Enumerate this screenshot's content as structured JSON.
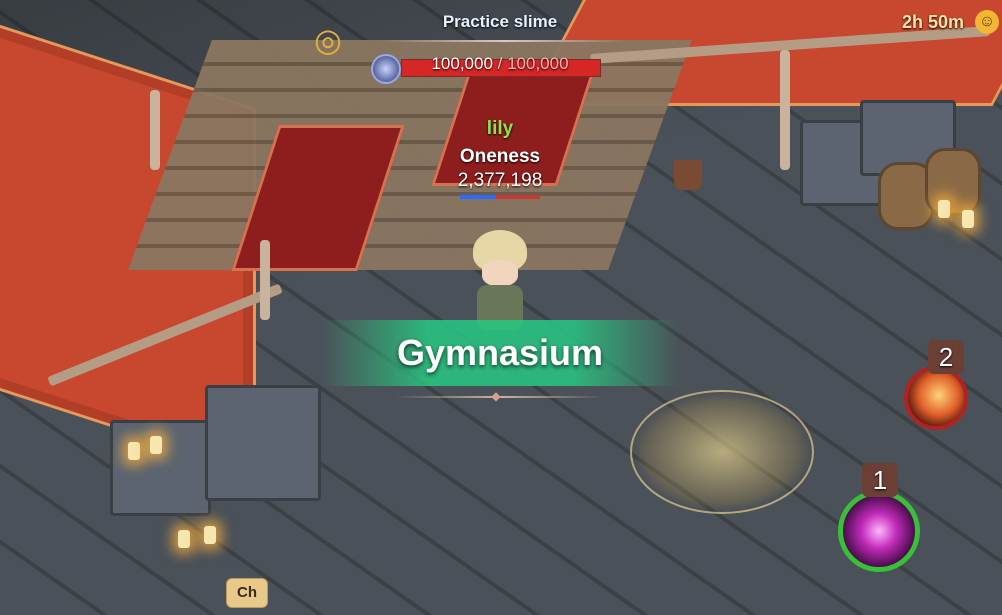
{
  "boss": {
    "name": "Practice slime",
    "hp_current": "100,000",
    "hp_separator": " / ",
    "hp_max": "100,000",
    "hp_fraction": 1.0
  },
  "timer": {
    "label": "2h 50m"
  },
  "player": {
    "name": "lily",
    "title": "Oneness",
    "power": "2,377,198"
  },
  "location": {
    "name": "Gymnasium"
  },
  "skills": {
    "skill_1_number": "1",
    "skill_2_number": "2"
  },
  "chat": {
    "label": "Ch"
  },
  "colors": {
    "location_banner": "#28c882",
    "hp_fill": "#d62727",
    "player_name": "#8ee24a",
    "skill_1_ring": "#38c038",
    "skill_2_ring": "#b22222"
  },
  "icons": {
    "target": "target-icon",
    "hp_orb": "hp-orb-icon",
    "timer": "clock-icon"
  }
}
